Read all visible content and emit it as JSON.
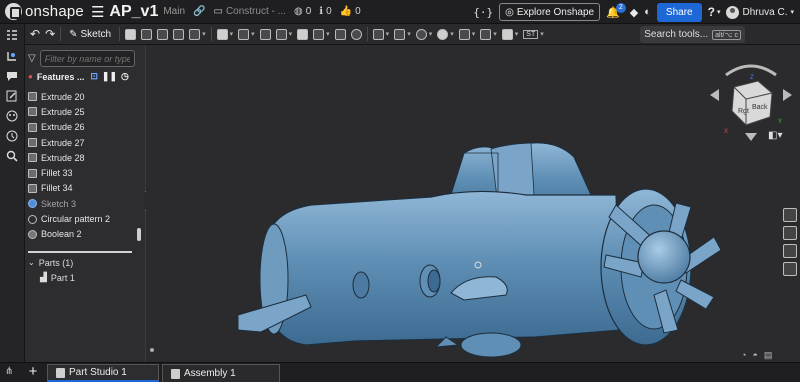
{
  "topbar": {
    "brand": "onshape",
    "doc_name": "AP_v1",
    "branch": "Main",
    "crumb": "Construct - ...",
    "globe_count": "0",
    "info_count": "0",
    "likes_count": "0",
    "curly": "{·}",
    "explore": "Explore Onshape",
    "notif_count": "2",
    "share": "Share",
    "help": "?",
    "user": "Dhruva C."
  },
  "toolbar": {
    "sketch_label": "Sketch",
    "search_label": "Search tools...",
    "search_shortcut": "alt/⌥ c",
    "st_label": "ST"
  },
  "panel": {
    "filter_placeholder": "Filter by name or type",
    "features_title": "Features ...",
    "features": [
      {
        "label": "Extrude 20",
        "type": "extrude",
        "dim": false
      },
      {
        "label": "Extrude 25",
        "type": "extrude",
        "dim": false
      },
      {
        "label": "Extrude 26",
        "type": "extrude",
        "dim": false
      },
      {
        "label": "Extrude 27",
        "type": "extrude",
        "dim": false
      },
      {
        "label": "Extrude 28",
        "type": "extrude",
        "dim": false
      },
      {
        "label": "Fillet 33",
        "type": "fillet",
        "dim": false
      },
      {
        "label": "Fillet 34",
        "type": "fillet",
        "dim": false
      },
      {
        "label": "Sketch 3",
        "type": "sketch",
        "dim": true
      },
      {
        "label": "Circular pattern 2",
        "type": "pattern",
        "dim": false
      },
      {
        "label": "Boolean 2",
        "type": "boolean",
        "dim": false
      }
    ],
    "parts_label": "Parts (1)",
    "part_item": "Part 1"
  },
  "viewcube": {
    "front": "Back",
    "side": "Rgt",
    "axis_x": "X",
    "axis_y": "Y",
    "axis_z": "Z"
  },
  "tabs": [
    {
      "label": "Part Studio 1",
      "active": true
    },
    {
      "label": "Assembly 1",
      "active": false
    }
  ],
  "colors": {
    "part_fill": "#5f8fb5",
    "accent": "#1e67d6",
    "background": "#2b2b2e"
  }
}
